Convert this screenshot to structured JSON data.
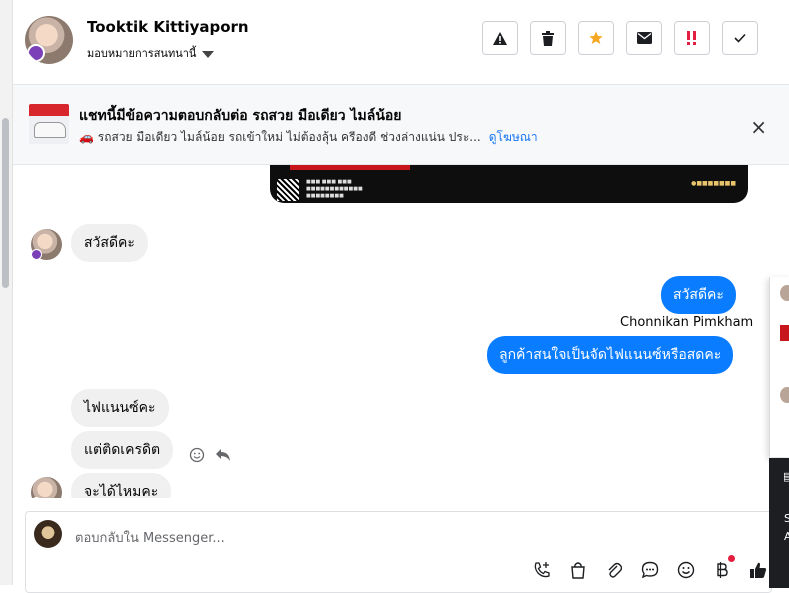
{
  "header": {
    "contact_name": "Tooktik Kittiyaporn",
    "assign_label": "มอบหมายการสนทนานี้",
    "actions": [
      "spam-warning",
      "delete",
      "star",
      "mark-unread",
      "mark-important",
      "done"
    ]
  },
  "ad_banner": {
    "title": "แชทนี้มีข้อความตอบกลับต่อ รถสวย มือเดียว ไมล์น้อย",
    "subtitle_emoji": "🚗",
    "subtitle": "รถสวย มือเดียว ไมล์น้อย รถเข้าใหม่ ไม่ต้องลุ้น ครีองดี ช่วงล่างแน่น ประ...",
    "link": "ดูโฆษณา",
    "close": "×"
  },
  "messages": {
    "in_1": "สวัสดีคะ",
    "out_1": "สวัสดีคะ",
    "sender_name": "Chonnikan Pimkham",
    "out_2": "ลูกค้าสนใจเป็นจัดไฟแนนซ์หรือสดคะ",
    "in_2": "ไฟแนนซ์คะ",
    "in_3": "แต่ติดเครดิต",
    "in_4": "จะได้ไหมคะ"
  },
  "composer": {
    "placeholder": "ตอบกลับใน Messenger..."
  },
  "right_panel": {
    "letter_1": "S",
    "letter_2": "A"
  },
  "colors": {
    "outgoing_bubble": "#0a7cff",
    "incoming_bubble": "#f0f0f0",
    "link": "#1877f2",
    "star": "#f5a623",
    "important": "#e41e3f"
  }
}
